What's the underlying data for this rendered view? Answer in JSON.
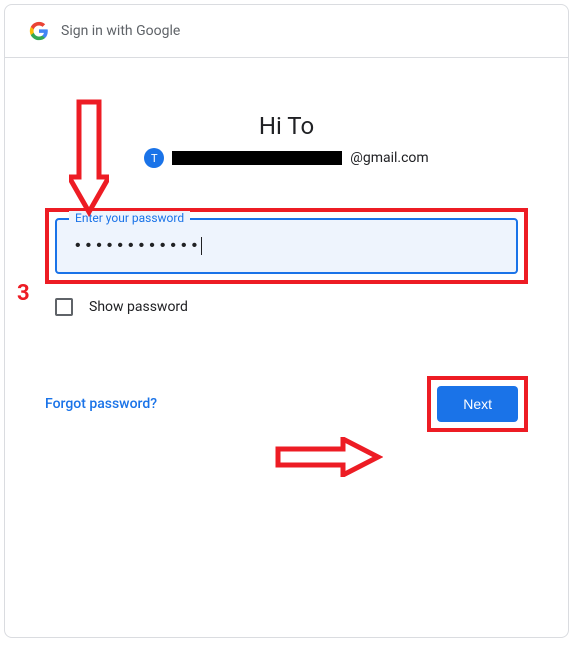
{
  "header": {
    "title": "Sign in with Google"
  },
  "greeting": "Hi To",
  "account": {
    "avatar_letter": "T",
    "email_suffix": "@gmail.com"
  },
  "password_field": {
    "label": "Enter your password",
    "masked_value": "••••••••••••"
  },
  "show_password": {
    "label": "Show password",
    "checked": false
  },
  "actions": {
    "forgot": "Forgot password?",
    "next": "Next"
  },
  "annotations": {
    "step_number": "3",
    "color": "#ed1c24"
  }
}
